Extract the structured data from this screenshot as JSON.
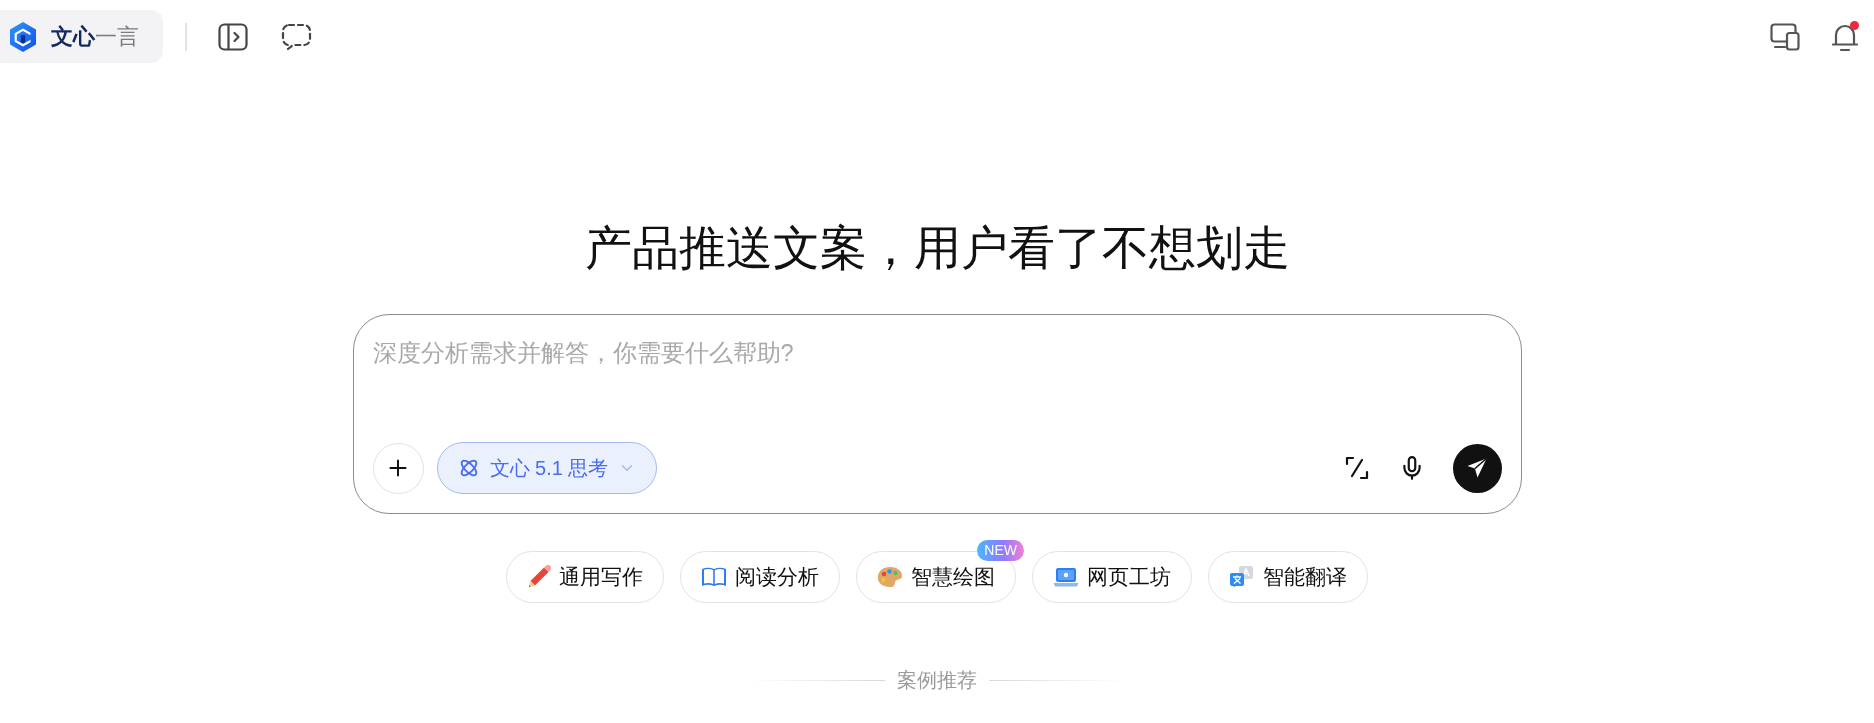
{
  "header": {
    "brand": "**文心**一言",
    "notifications": {
      "unread": true
    }
  },
  "hero": {
    "title": "产品推送文案，用户看了不想划走"
  },
  "composer": {
    "placeholder": "深度分析需求并解答，你需要什么帮助?",
    "model": {
      "label": "文心 5.1 思考"
    }
  },
  "quick_actions": [
    {
      "label": "通用写作"
    },
    {
      "label": "阅读分析"
    },
    {
      "label": "智慧绘图",
      "badge": "NEW"
    },
    {
      "label": "网页工坊"
    },
    {
      "label": "智能翻译"
    }
  ],
  "section": {
    "title": "案例推荐"
  }
}
